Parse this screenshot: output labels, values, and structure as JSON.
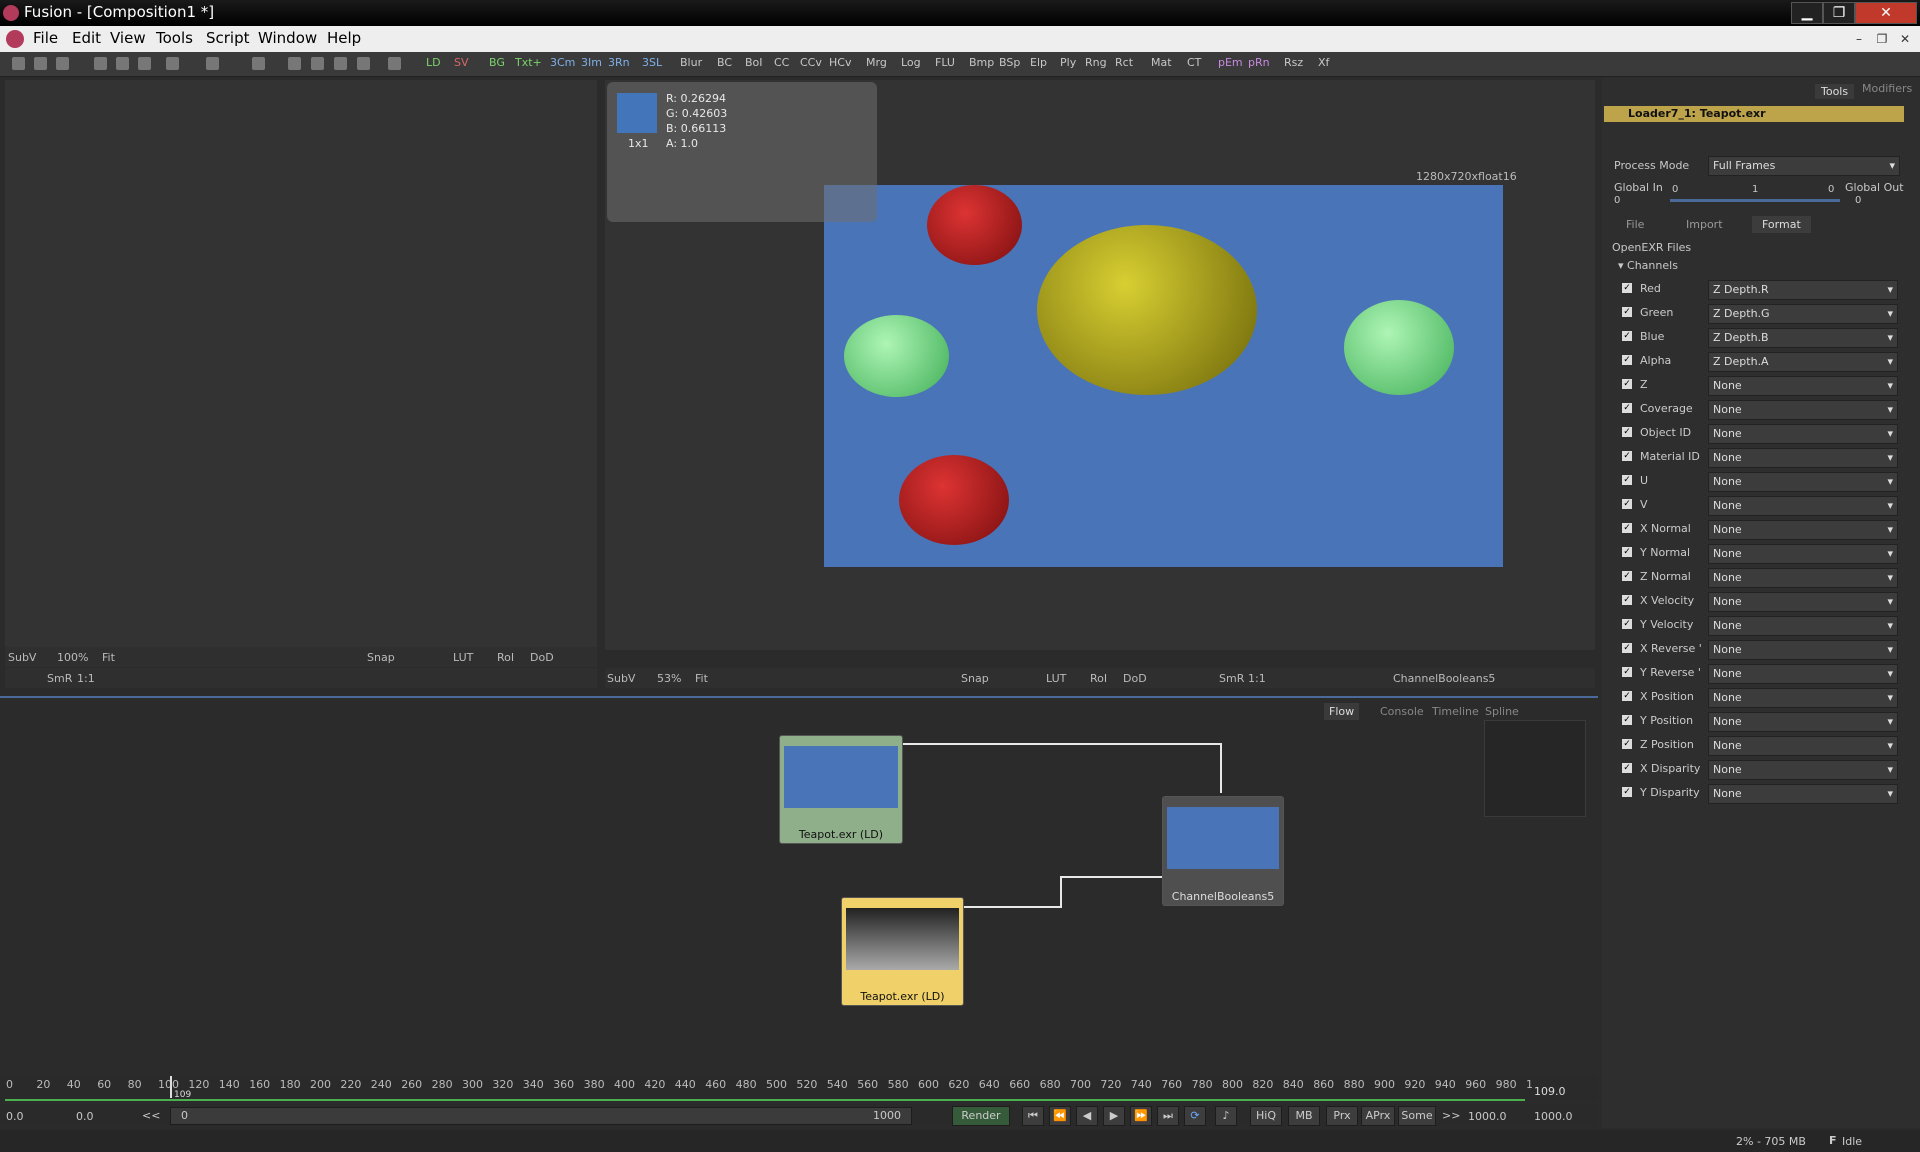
{
  "window": {
    "title": "Fusion - [Composition1 *]"
  },
  "menu": [
    "File",
    "Edit",
    "View",
    "Tools",
    "Script",
    "Window",
    "Help"
  ],
  "toolbar_tools": [
    "LD",
    "SV",
    "BG",
    "Txt+",
    "3Cm",
    "3Im",
    "3Rn",
    "3SL",
    "Blur",
    "BC",
    "BoI",
    "CC",
    "CCv",
    "HCv",
    "Mrg",
    "Log",
    "FLU",
    "Bmp",
    "BSp",
    "Elp",
    "Ply",
    "Rng",
    "Rct",
    "Mat",
    "CT",
    "pEm",
    "pRn",
    "Rsz",
    "Xf"
  ],
  "viewer_left": {
    "bar1": [
      "SubV",
      "100%",
      "Fit",
      "Snap",
      "LUT",
      "RoI",
      "DoD"
    ],
    "bar2": [
      "SmR",
      "1:1"
    ]
  },
  "viewer_right": {
    "bar": [
      "SubV",
      "53%",
      "Fit",
      "Snap",
      "LUT",
      "RoI",
      "DoD",
      "SmR",
      "1:1"
    ],
    "node_name": "ChannelBooleans5",
    "resolution": "1280x720xfloat16"
  },
  "pixel_info": {
    "r": "R: 0.26294",
    "g": "G: 0.42603",
    "b": "B: 0.66113",
    "a": "A: 1.0",
    "sample": "1x1"
  },
  "right_panel": {
    "tabs": [
      "Tools",
      "Modifiers"
    ],
    "tool_header": "Loader7_1: Teapot.exr",
    "process_mode_label": "Process Mode",
    "process_mode_value": "Full Frames",
    "global_in_label": "Global In",
    "global_in": "0",
    "global_out_label": "Global Out",
    "global_out": "0",
    "slider_left": "0",
    "slider_mid": "1",
    "slider_right": "0",
    "subtabs": [
      "File",
      "Import",
      "Format"
    ],
    "section": "OpenEXR Files",
    "group": "Channels",
    "channels": [
      {
        "label": "Red",
        "value": "Z Depth.R"
      },
      {
        "label": "Green",
        "value": "Z Depth.G"
      },
      {
        "label": "Blue",
        "value": "Z Depth.B"
      },
      {
        "label": "Alpha",
        "value": "Z Depth.A"
      },
      {
        "label": "Z",
        "value": "None"
      },
      {
        "label": "Coverage",
        "value": "None"
      },
      {
        "label": "Object ID",
        "value": "None"
      },
      {
        "label": "Material ID",
        "value": "None"
      },
      {
        "label": "U",
        "value": "None"
      },
      {
        "label": "V",
        "value": "None"
      },
      {
        "label": "X Normal",
        "value": "None"
      },
      {
        "label": "Y Normal",
        "value": "None"
      },
      {
        "label": "Z Normal",
        "value": "None"
      },
      {
        "label": "X Velocity",
        "value": "None"
      },
      {
        "label": "Y Velocity",
        "value": "None"
      },
      {
        "label": "X Reverse '",
        "value": "None"
      },
      {
        "label": "Y Reverse '",
        "value": "None"
      },
      {
        "label": "X Position",
        "value": "None"
      },
      {
        "label": "Y Position",
        "value": "None"
      },
      {
        "label": "Z Position",
        "value": "None"
      },
      {
        "label": "X Disparity",
        "value": "None"
      },
      {
        "label": "Y Disparity",
        "value": "None"
      }
    ]
  },
  "flow": {
    "tabs": [
      "Flow",
      "Console",
      "Timeline",
      "Spline"
    ],
    "nodes": {
      "loader_a": "Teapot.exr  (LD)",
      "loader_b": "Teapot.exr  (LD)",
      "boolean": "ChannelBooleans5"
    }
  },
  "timeline": {
    "ticks": [
      "0",
      "20",
      "40",
      "60",
      "80",
      "100",
      "120",
      "140",
      "160",
      "180",
      "200",
      "220",
      "240",
      "260",
      "280",
      "300",
      "320",
      "340",
      "360",
      "380",
      "400",
      "420",
      "440",
      "460",
      "480",
      "500",
      "520",
      "540",
      "560",
      "580",
      "600",
      "620",
      "640",
      "660",
      "680",
      "700",
      "720",
      "740",
      "760",
      "780",
      "800",
      "820",
      "840",
      "860",
      "880",
      "900",
      "920",
      "940",
      "960",
      "980",
      "1"
    ],
    "current_frame": "109.0",
    "current_marker": "109"
  },
  "transport": {
    "start": "0.0",
    "render_start": "0.0",
    "range_start": "0",
    "range_end": "1000",
    "render_label": "Render",
    "hiq": "HiQ",
    "mb": "MB",
    "prx": "Prx",
    "aprx": "APrx",
    "some": "Some",
    "render_end": "1000.0",
    "end": "1000.0"
  },
  "status": {
    "memory": "2% - 705 MB",
    "state": "Idle"
  }
}
